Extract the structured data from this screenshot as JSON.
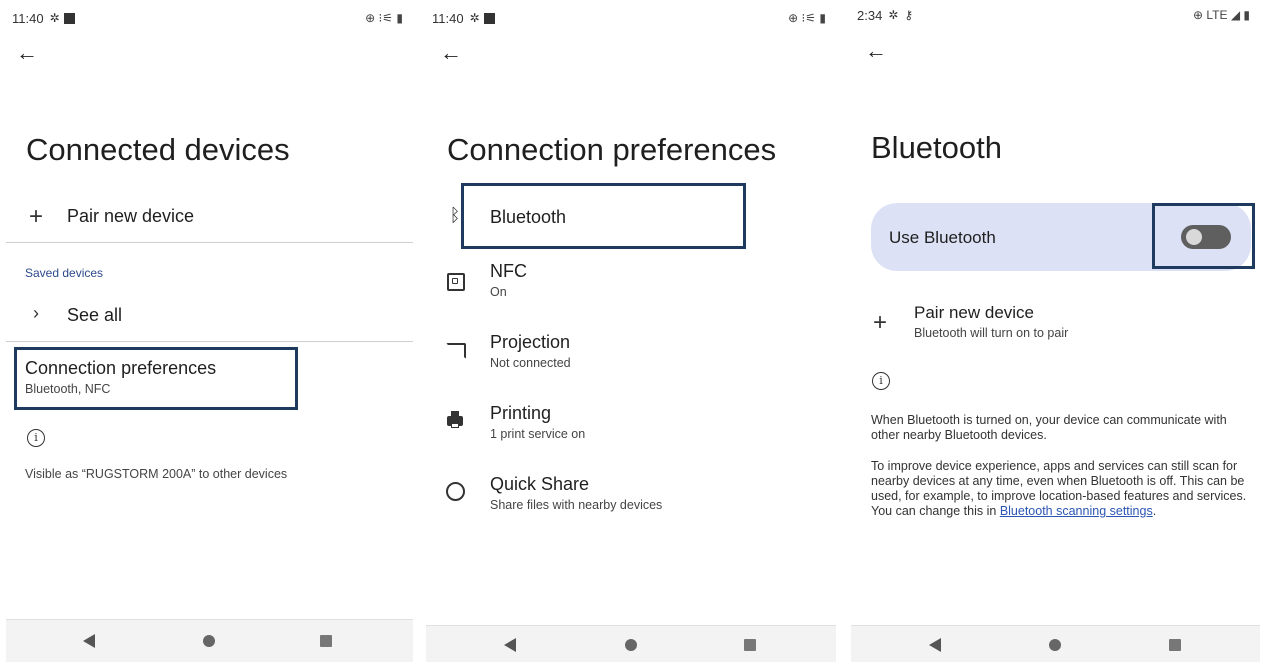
{
  "screen1": {
    "status": {
      "time": "11:40",
      "icons_right": "⊕ ⁝⚟ ▮"
    },
    "title": "Connected devices",
    "pair_label": "Pair new device",
    "section_saved": "Saved devices",
    "see_all_label": "See all",
    "conn_pref_title": "Connection preferences",
    "conn_pref_sub": "Bluetooth, NFC",
    "visible_text": "Visible as “RUGSTORM 200A” to other devices"
  },
  "screen2": {
    "status": {
      "time": "11:40",
      "icons_right": "⊕ ⁝⚟ ▮"
    },
    "title": "Connection preferences",
    "items": [
      {
        "title": "Bluetooth",
        "sub": ""
      },
      {
        "title": "NFC",
        "sub": "On"
      },
      {
        "title": "Projection",
        "sub": "Not connected"
      },
      {
        "title": "Printing",
        "sub": "1 print service on"
      },
      {
        "title": "Quick Share",
        "sub": "Share files with nearby devices"
      }
    ]
  },
  "screen3": {
    "status": {
      "time": "2:34",
      "icons_right": "⊕ LTE ◢ ▮"
    },
    "title": "Bluetooth",
    "use_bt_label": "Use Bluetooth",
    "use_bt_on": false,
    "pair_title": "Pair new device",
    "pair_sub": "Bluetooth will turn on to pair",
    "info_p1": "When Bluetooth is turned on, your device can communicate with other nearby Bluetooth devices.",
    "info_p2_pre": "To improve device experience, apps and services can still scan for nearby devices at any time, even when Bluetooth is off. This can be used, for example, to improve location-based features and services. You can change this in ",
    "info_p2_link": "Bluetooth scanning settings",
    "info_p2_post": "."
  },
  "colors": {
    "highlight": "#1e3a5f",
    "card": "#dde1f5",
    "link": "#2b55b3",
    "section": "#2c4a8c"
  },
  "icons": [
    "back-arrow-icon",
    "plus-icon",
    "chevron-right-icon",
    "info-icon",
    "bluetooth-icon",
    "nfc-icon",
    "cast-icon",
    "printer-icon",
    "quick-share-icon",
    "gear-icon"
  ]
}
